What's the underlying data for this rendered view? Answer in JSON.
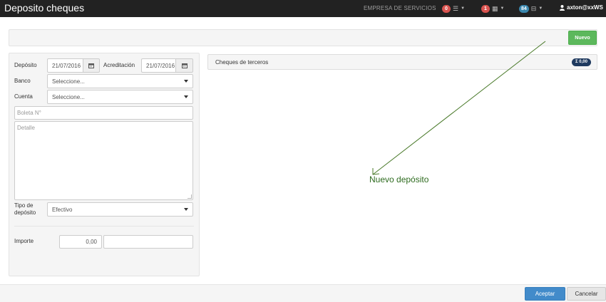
{
  "header": {
    "title": "Deposito cheques",
    "company": "EMPRESA DE SERVICIOS",
    "badges": [
      {
        "count": "0",
        "icon": "list-icon",
        "color": "#d9534f"
      },
      {
        "count": "1",
        "icon": "calendar-icon",
        "color": "#d9534f"
      },
      {
        "count": "84",
        "icon": "inbox-icon",
        "color": "#3a87ad"
      }
    ],
    "user": "axton@xxWS"
  },
  "toolbar": {
    "new_label": "Nuevo"
  },
  "form": {
    "deposit_label": "Depósito",
    "deposit_date": "21/07/2016",
    "accreditation_label": "Acreditación",
    "accreditation_date": "21/07/2016",
    "bank_label": "Banco",
    "bank_value": "Seleccione...",
    "account_label": "Cuenta",
    "account_value": "Seleccione...",
    "ticket_placeholder": "Boleta N°",
    "detail_placeholder": "Detalle",
    "deposit_type_label": "Tipo de depósito",
    "deposit_type_value": "Efectivo",
    "amount_label": "Importe",
    "amount_value": "0,00"
  },
  "cheques_panel": {
    "title": "Cheques de terceros",
    "sum_badge": "Σ 0,00"
  },
  "annotation": "Nuevo depósito",
  "footer": {
    "accept_label": "Aceptar",
    "cancel_label": "Cancelar"
  },
  "colors": {
    "accent_green": "#5cb85c",
    "accent_blue": "#428bca",
    "annotation_green": "#2e6b1f"
  }
}
